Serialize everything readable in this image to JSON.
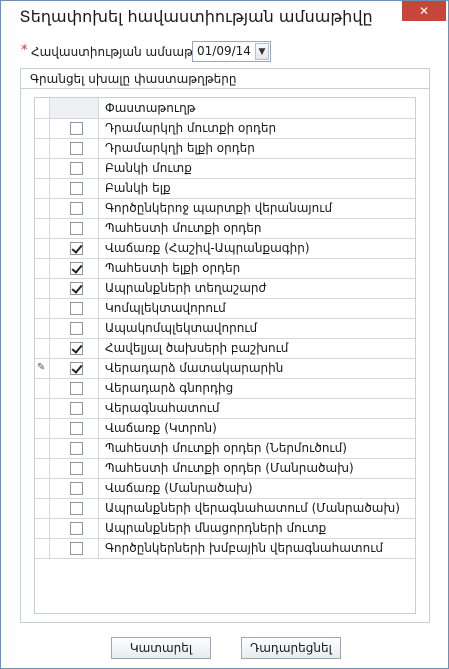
{
  "window": {
    "title": "Տեղափոխել հավաստիության ամսաթիվը",
    "close_icon": "close-icon",
    "close_glyph": "✕"
  },
  "date_field": {
    "required_mark": "*",
    "label": "Հավաստիության ամսաթիվ",
    "value": "01/09/14",
    "dropdown_glyph": "▼"
  },
  "group": {
    "title": "Գրանցել սխալը փաստաթղթերը"
  },
  "grid": {
    "header": "Փաստաթուղթ",
    "edit_icon_glyph": "✎",
    "rows": [
      {
        "label": "Դրամարկղի մուտքի օրդեր",
        "checked": false
      },
      {
        "label": "Դրամարկղի ելքի օրդեր",
        "checked": false
      },
      {
        "label": "Բանկի մուտք",
        "checked": false
      },
      {
        "label": "Բանկի ելք",
        "checked": false
      },
      {
        "label": "Գործընկերոջ պարտքի վերանայում",
        "checked": false
      },
      {
        "label": "Պահեստի մուտքի օրդեր",
        "checked": false
      },
      {
        "label": "Վաճառք (Հաշիվ-Ապրանքագիր)",
        "checked": true
      },
      {
        "label": "Պահեստի ելքի օրդեր",
        "checked": true
      },
      {
        "label": "Ապրանքների տեղաշարժ",
        "checked": true
      },
      {
        "label": "Կոմպլեկտավորում",
        "checked": false
      },
      {
        "label": "Ապակոմպլեկտավորում",
        "checked": false
      },
      {
        "label": "Հավելյալ ծախսերի բաշխում",
        "checked": true
      },
      {
        "label": "Վերադարձ մատակարարին",
        "checked": true,
        "editing": true
      },
      {
        "label": "Վերադարձ գնորդից",
        "checked": false
      },
      {
        "label": "Վերագնահատում",
        "checked": false
      },
      {
        "label": "Վաճառք (Կտրոն)",
        "checked": false
      },
      {
        "label": "Պահեստի մուտքի օրդեր (Ներմուծում)",
        "checked": false
      },
      {
        "label": "Պահեստի մուտքի օրդեր (Մանրածախ)",
        "checked": false
      },
      {
        "label": "Վաճառք (Մանրածախ)",
        "checked": false
      },
      {
        "label": "Ապրանքների վերագնահատում (Մանրածախ)",
        "checked": false
      },
      {
        "label": "Ապրանքների մնացորդների մուտք",
        "checked": false
      },
      {
        "label": "Գործընկերների խմբային վերագնահատում",
        "checked": false
      }
    ]
  },
  "buttons": {
    "ok": "Կատարել",
    "cancel": "Դադարեցնել"
  }
}
